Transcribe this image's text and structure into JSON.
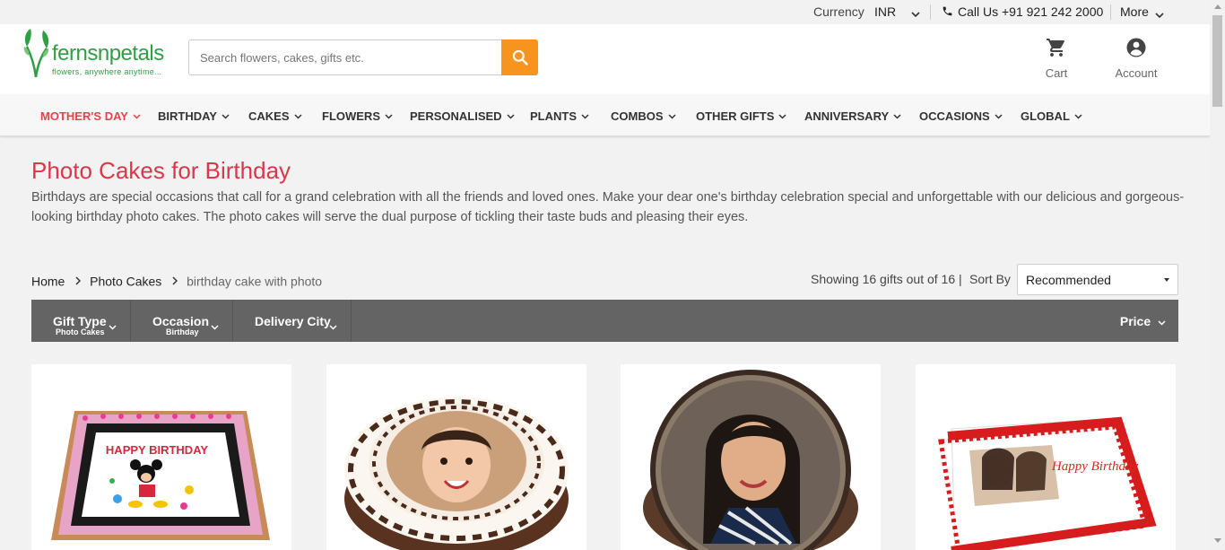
{
  "topbar": {
    "currency_label": "Currency",
    "currency_value": "INR",
    "call_text": "Call Us +91 921 242 2000",
    "more_label": "More"
  },
  "header": {
    "logo_brand": "fernsnpetals",
    "logo_tagline": "flowers, anywhere anytime...",
    "search_placeholder": "Search flowers, cakes, gifts etc.",
    "cart_label": "Cart",
    "account_label": "Account"
  },
  "nav": {
    "items": [
      {
        "label": "MOTHER'S DAY"
      },
      {
        "label": "BIRTHDAY"
      },
      {
        "label": "CAKES"
      },
      {
        "label": "FLOWERS"
      },
      {
        "label": "PERSONALISED"
      },
      {
        "label": "PLANTS"
      },
      {
        "label": "COMBOS"
      },
      {
        "label": "OTHER GIFTS"
      },
      {
        "label": "ANNIVERSARY"
      },
      {
        "label": "OCCASIONS"
      },
      {
        "label": "GLOBAL"
      }
    ]
  },
  "page": {
    "title": "Photo Cakes for Birthday",
    "description": "Birthdays are special occasions that call for a grand celebration with all the friends and loved ones. Make your dear one's birthday celebration special and unforgettable with our delicious and gorgeous-looking birthday photo cakes. The photo cakes will serve the dual purpose of tickling their taste buds and pleasing their eyes."
  },
  "breadcrumb": {
    "home": "Home",
    "photo_cakes": "Photo Cakes",
    "current": "birthday cake with photo"
  },
  "results": {
    "showing_text": "Showing 16 gifts out of 16 |",
    "sort_label": "Sort By",
    "sort_value": "Recommended"
  },
  "filters": {
    "gift_type": {
      "label": "Gift Type",
      "value": "Photo Cakes"
    },
    "occasion": {
      "label": "Occasion",
      "value": "Birthday"
    },
    "delivery_city": {
      "label": "Delivery City"
    },
    "price": {
      "label": "Price"
    }
  },
  "cards": {
    "card1_text": "HAPPY BIRTHDAY",
    "card4_text": "Happy Birthday"
  },
  "colors": {
    "accent_red": "#d9384a",
    "search_orange": "#f7941d",
    "filter_bar": "#646464",
    "logo_green": "#2f9e44"
  }
}
